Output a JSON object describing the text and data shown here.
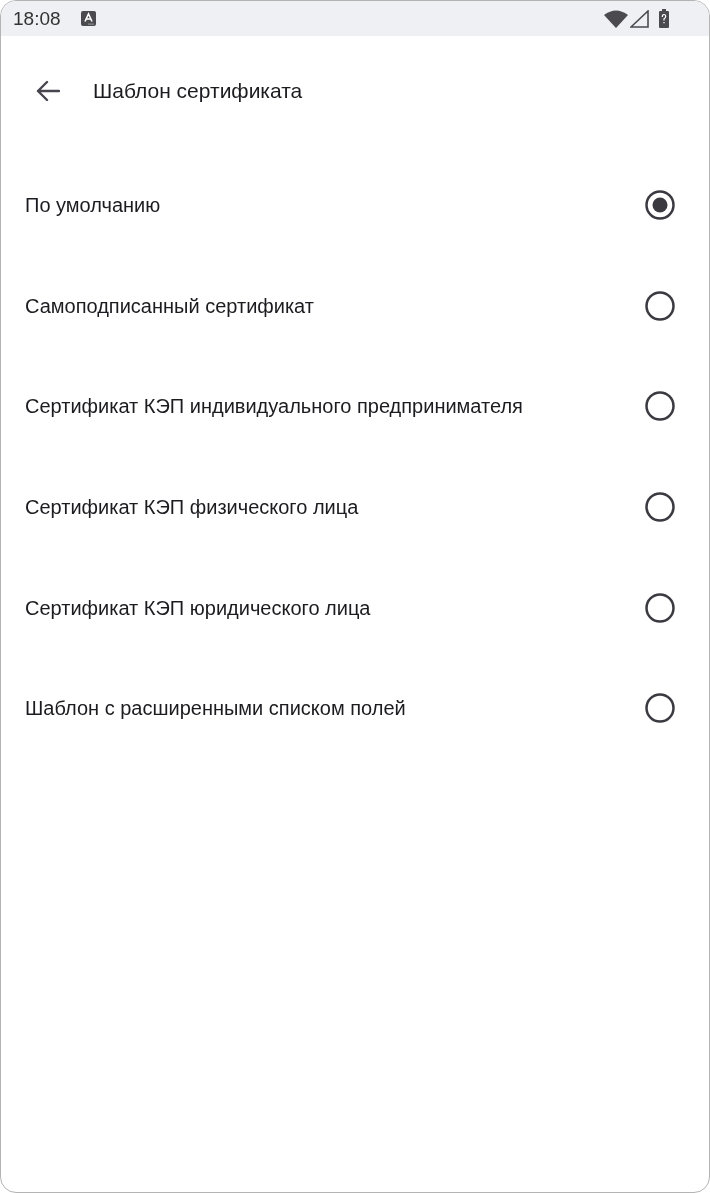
{
  "status_bar": {
    "time": "18:08"
  },
  "app_bar": {
    "title": "Шаблон сертификата"
  },
  "options": [
    {
      "label": "По умолчанию",
      "selected": true
    },
    {
      "label": "Самоподписанный сертификат",
      "selected": false
    },
    {
      "label": "Сертификат КЭП индивидуального предпринимателя",
      "selected": false
    },
    {
      "label": "Сертификат КЭП физического лица",
      "selected": false
    },
    {
      "label": "Сертификат КЭП юридического лица",
      "selected": false
    },
    {
      "label": "Шаблон с расширенными списком полей",
      "selected": false
    }
  ]
}
